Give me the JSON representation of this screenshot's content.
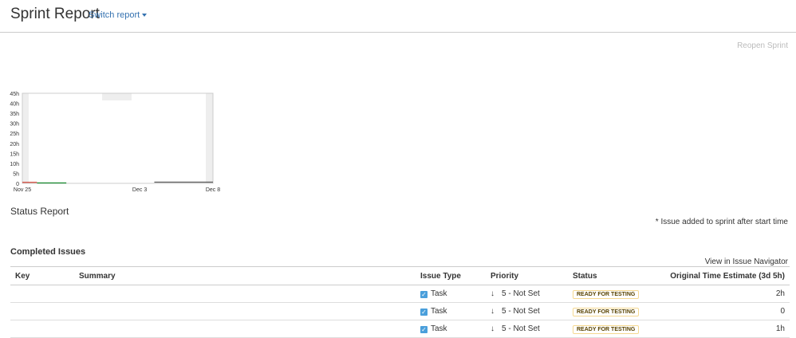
{
  "header": {
    "title": "Sprint Report",
    "switch_label": "Switch report"
  },
  "actions": {
    "reopen_label": "Reopen Sprint"
  },
  "chart_data": {
    "type": "line",
    "y_ticks": [
      "45h",
      "40h",
      "35h",
      "30h",
      "25h",
      "20h",
      "15h",
      "10h",
      "5h",
      "0"
    ],
    "x_ticks": [
      "Nov 25",
      "Dec 3",
      "Dec 8"
    ],
    "ylim_hours": [
      0,
      45
    ],
    "series": [
      {
        "color": "#d04437",
        "values": [
          {
            "x": "Nov 25",
            "y": 0.5
          },
          {
            "x": "Nov 26",
            "y": 0.5
          }
        ]
      },
      {
        "color": "#14892c",
        "values": [
          {
            "x": "Nov 26",
            "y": 0.2
          },
          {
            "x": "Nov 28",
            "y": 0.2
          }
        ]
      },
      {
        "color": "#555555",
        "values": [
          {
            "x": "Dec 4",
            "y": 0.6
          },
          {
            "x": "Dec 8",
            "y": 0.6
          }
        ]
      }
    ]
  },
  "status_report": "Status Report",
  "note": "* Issue added to sprint after start time",
  "completed": {
    "title": "Completed Issues",
    "navigator_link": "View in Issue Navigator",
    "columns": [
      "Key",
      "Summary",
      "Issue Type",
      "Priority",
      "Status",
      "Original Time Estimate (3d 5h)"
    ],
    "rows": [
      {
        "key": "",
        "summary": "",
        "type": "Task",
        "priority": "5 - Not Set",
        "status": "READY FOR TESTING",
        "estimate": "2h"
      },
      {
        "key": "",
        "summary": "",
        "type": "Task",
        "priority": "5 - Not Set",
        "status": "READY FOR TESTING",
        "estimate": "0"
      },
      {
        "key": "",
        "summary": "",
        "type": "Task",
        "priority": "5 - Not Set",
        "status": "READY FOR TESTING",
        "estimate": "1h"
      }
    ]
  },
  "colors": {
    "link": "#3572b0",
    "status_border": "#f5d890",
    "task_icon": "#4a9fdb",
    "non_working_band": "#eeeeee"
  },
  "icons": {
    "task": "checkbox-task-icon",
    "priority": "arrow-down-icon",
    "switch": "caret-down-icon"
  }
}
